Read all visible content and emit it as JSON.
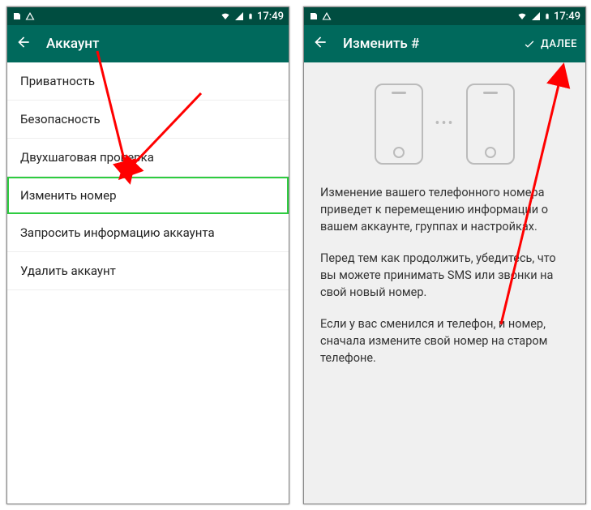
{
  "status": {
    "time": "17:49"
  },
  "left": {
    "title": "Аккаунт",
    "items": [
      "Приватность",
      "Безопасность",
      "Двухшаговая проверка",
      "Изменить номер",
      "Запросить информацию аккаунта",
      "Удалить аккаунт"
    ],
    "highlight_index": 3
  },
  "right": {
    "title": "Изменить #",
    "next_label": "ДАЛЕЕ",
    "paragraphs": [
      "Изменение вашего телефонного номера приведет к перемещению информации о вашем аккаунте, группах и настройках.",
      "Перед тем как продолжить, убедитесь, что вы можете принимать SMS или звонки на свой новый номер.",
      "Если у вас сменился и телефон, и номер, сначала измените свой номер на старом телефоне."
    ]
  }
}
